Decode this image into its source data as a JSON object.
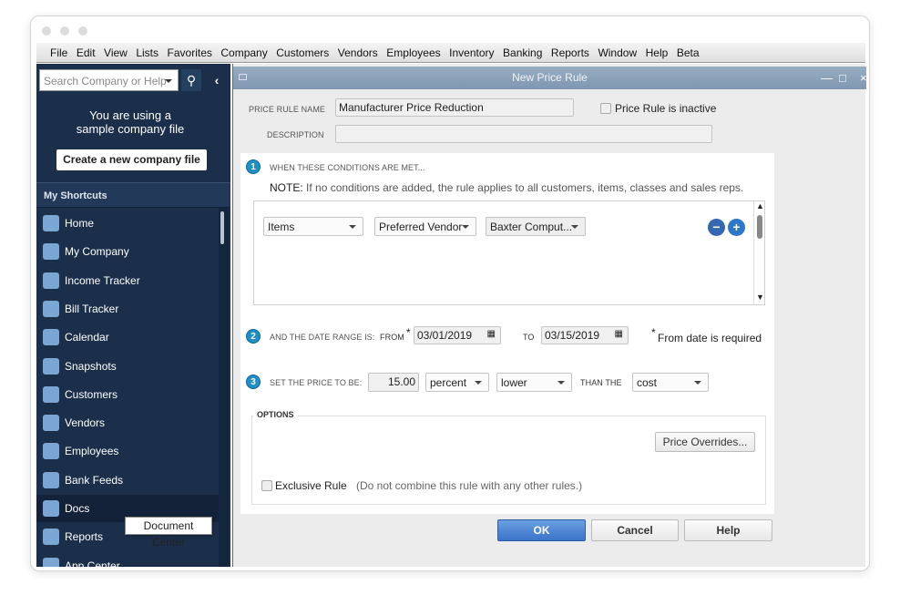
{
  "menu": [
    "File",
    "Edit",
    "View",
    "Lists",
    "Favorites",
    "Company",
    "Customers",
    "Vendors",
    "Employees",
    "Inventory",
    "Banking",
    "Reports",
    "Window",
    "Help",
    "Beta"
  ],
  "sidebar": {
    "search_placeholder": "Search Company or Help",
    "sample_notice": "You are using a sample company file",
    "create_button": "Create a new company file",
    "shortcuts_header": "My Shortcuts",
    "items": [
      {
        "label": "Home",
        "icon": "home-icon"
      },
      {
        "label": "My Company",
        "icon": "my-company-icon"
      },
      {
        "label": "Income Tracker",
        "icon": "income-tracker-icon"
      },
      {
        "label": "Bill Tracker",
        "icon": "bill-tracker-icon"
      },
      {
        "label": "Calendar",
        "icon": "calendar-icon"
      },
      {
        "label": "Snapshots",
        "icon": "snapshots-icon"
      },
      {
        "label": "Customers",
        "icon": "customers-icon"
      },
      {
        "label": "Vendors",
        "icon": "vendors-icon"
      },
      {
        "label": "Employees",
        "icon": "employees-icon"
      },
      {
        "label": "Bank Feeds",
        "icon": "bank-icon"
      },
      {
        "label": "Docs",
        "icon": "docs-icon"
      },
      {
        "label": "Reports",
        "icon": "reports-icon"
      },
      {
        "label": "App Center",
        "icon": "app-center-icon"
      }
    ],
    "tooltip": "Document Center"
  },
  "dialog": {
    "title": "New Price Rule",
    "name_label": "PRICE RULE NAME",
    "name_value": "Manufacturer Price Reduction",
    "inactive_label": "Price Rule is inactive",
    "description_label": "DESCRIPTION",
    "description_value": "",
    "step1": {
      "num": "1",
      "label": "WHEN THESE CONDITIONS ARE MET...",
      "note_bold": "NOTE:",
      "note": "If no conditions are added, the rule applies to all customers, items, classes and sales reps.",
      "conditions": [
        "Items",
        "Preferred Vendor",
        "Baxter Comput..."
      ]
    },
    "step2": {
      "num": "2",
      "label": "AND THE DATE RANGE IS:",
      "from_label": "FROM",
      "from": "03/01/2019",
      "to_label": "TO",
      "to": "03/15/2019",
      "required_note": "From date is required",
      "asterisk": "*"
    },
    "step3": {
      "num": "3",
      "label": "SET THE PRICE TO BE:",
      "amount": "15.00",
      "unit": "percent",
      "direction": "lower",
      "than_label": "THAN THE",
      "basis": "cost"
    },
    "options": {
      "label": "OPTIONS",
      "overrides_button": "Price Overrides...",
      "exclusive_label": "Exclusive Rule",
      "exclusive_note": "(Do not combine this rule with any other rules.)"
    },
    "buttons": {
      "ok": "OK",
      "cancel": "Cancel",
      "help": "Help"
    }
  },
  "colors": {
    "sidebar": "#1b2f4a",
    "accent": "#2e76c7",
    "titlebar": "#8fa6bc"
  }
}
